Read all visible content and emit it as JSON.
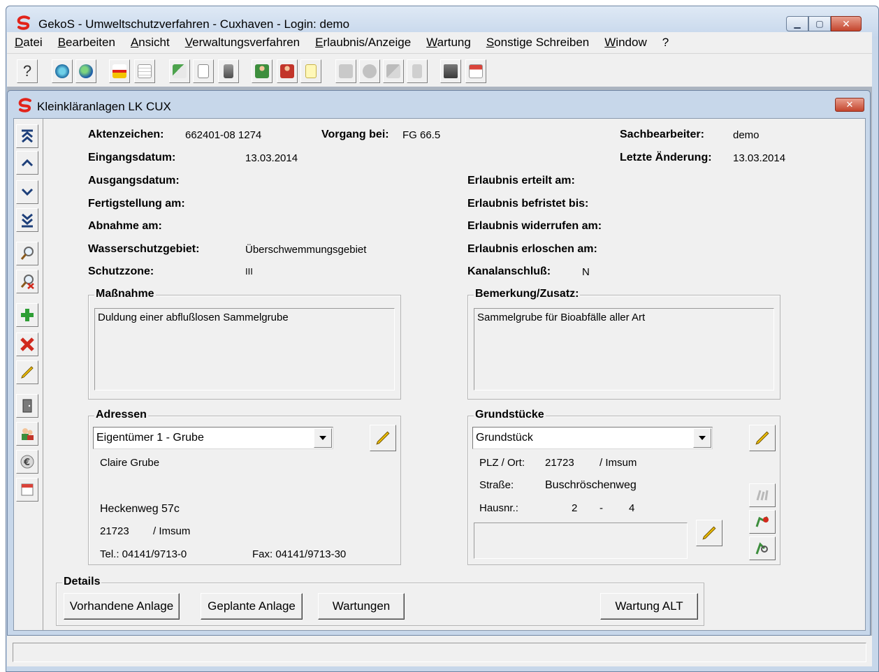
{
  "app": {
    "title": "GekoS - Umweltschutzverfahren - Cuxhaven  - Login: demo",
    "brand_color": "#e2231a"
  },
  "menu": [
    "Datei",
    "Bearbeiten",
    "Ansicht",
    "Verwaltungsverfahren",
    "Erlaubnis/Anzeige",
    "Wartung",
    "Sonstige Schreiben",
    "Window",
    "?"
  ],
  "toolbar": {
    "help_label": "?",
    "icons": [
      "help-icon",
      "search-globe-icon",
      "globe-icon",
      "document-warning-icon",
      "warning-table-icon",
      "export-icon",
      "blank-document-icon",
      "copy-document-icon",
      "person-green-icon",
      "person-red-icon",
      "note-icon",
      "copy-disabled-icon",
      "paste-disabled-icon",
      "cut-disabled-icon",
      "delete-disabled-icon",
      "info-document-icon",
      "calendar-document-icon"
    ]
  },
  "child": {
    "title": "Kleinkläranlagen LK CUX"
  },
  "fields": {
    "aktenzeichen_label": "Aktenzeichen:",
    "aktenzeichen_value": "662401-08  1274",
    "vorgang_label": "Vorgang bei:",
    "vorgang_value": "FG 66.5",
    "sachbearbeiter_label": "Sachbearbeiter:",
    "sachbearbeiter_value": "demo",
    "eingangsdatum_label": "Eingangsdatum:",
    "eingangsdatum_value": "13.03.2014",
    "letzte_aenderung_label": "Letzte Änderung:",
    "letzte_aenderung_value": "13.03.2014",
    "ausgangsdatum_label": "Ausgangsdatum:",
    "erteilt_label": "Erlaubnis erteilt am:",
    "fertigstellung_label": "Fertigstellung am:",
    "befristet_label": "Erlaubnis befristet bis:",
    "abnahme_label": "Abnahme am:",
    "widerrufen_label": "Erlaubnis widerrufen am:",
    "wasserschutz_label": "Wasserschutzgebiet:",
    "wasserschutz_value": "Überschwemmungsgebiet",
    "erloschen_label": "Erlaubnis erloschen am:",
    "schutzzone_label": "Schutzzone:",
    "schutzzone_value": "III",
    "kanal_label": "Kanalanschluß:",
    "kanal_value": "N"
  },
  "massnahme": {
    "title": "Maßnahme",
    "text": "Duldung einer abflußlosen Sammelgrube"
  },
  "bemerkung": {
    "title": "Bemerkung/Zusatz:",
    "text": "Sammelgrube für Bioabfälle aller Art"
  },
  "adressen": {
    "title": "Adressen",
    "selected": "Eigentümer 1   - Grube",
    "name": "Claire Grube",
    "street": "Heckenweg 57c",
    "plz": "21723",
    "city": "/  Imsum",
    "tel": "Tel.: 04141/9713-0",
    "fax": "Fax: 04141/9713-30"
  },
  "grundstuecke": {
    "title": "Grundstücke",
    "selected": "Grundstück",
    "plz_label": "PLZ / Ort:",
    "plz": "21723",
    "ort": "/  Imsum",
    "strasse_label": "Straße:",
    "strasse": "Buschröschenweg",
    "hausnr_label": "Hausnr.:",
    "hausnr_from": "2",
    "hausnr_sep": "-",
    "hausnr_to": "4"
  },
  "details": {
    "title": "Details",
    "buttons": [
      "Vorhandene Anlage",
      "Geplante Anlage",
      "Wartungen",
      "Wartung ALT"
    ]
  },
  "nav_icons": [
    "first-record-icon",
    "previous-record-icon",
    "next-record-icon",
    "last-record-icon",
    "search-icon",
    "search-clear-icon",
    "add-icon",
    "delete-icon",
    "edit-icon",
    "door-icon",
    "persons-icon",
    "euro-icon",
    "calendar-icon"
  ]
}
